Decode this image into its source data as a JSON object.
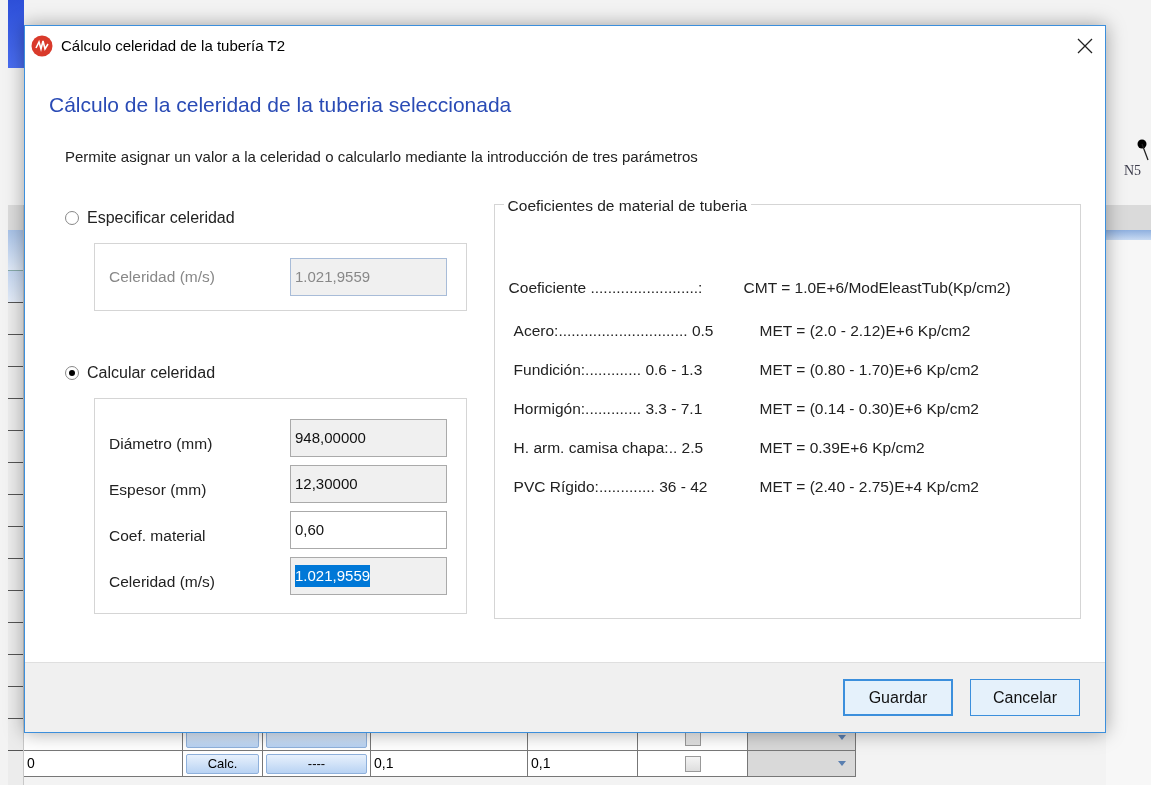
{
  "background": {
    "node_label": "N5",
    "table": {
      "rows": [
        {
          "checked": false
        },
        {
          "cells": [
            "0",
            "Calc.",
            "----",
            "0,1",
            "0,1"
          ],
          "checked": false
        }
      ]
    }
  },
  "dialog": {
    "title": "Cálculo celeridad de la tubería T2",
    "heading": "Cálculo de la celeridad de la tuberia seleccionada",
    "description": "Permite asignar un valor a la celeridad o calcularlo mediante la introducción de tres parámetros",
    "options": [
      {
        "label": "Especificar celeridad",
        "selected": false,
        "fields": [
          {
            "label": "Celeridad (m/s)",
            "value": "1.021,9559",
            "readonly": true,
            "disabled": true,
            "highlighted": false
          }
        ]
      },
      {
        "label": "Calcular celeridad",
        "selected": true,
        "fields": [
          {
            "label": "Diámetro (mm)",
            "value": "948,00000",
            "readonly": true,
            "disabled": false,
            "highlighted": false
          },
          {
            "label": "Espesor (mm)",
            "value": "12,30000",
            "readonly": true,
            "disabled": false,
            "highlighted": false
          },
          {
            "label": "Coef. material",
            "value": "0,60",
            "readonly": false,
            "disabled": false,
            "highlighted": false
          },
          {
            "label": "Celeridad (m/s)",
            "value": "1.021,9559",
            "readonly": true,
            "disabled": false,
            "highlighted": true
          }
        ]
      }
    ],
    "coefficients": {
      "title": "Coeficientes de material de tuberia",
      "header": {
        "label": "Coeficiente .........................:",
        "formula": "CMT = 1.0E+6/ModEleastTub(Kp/cm2)"
      },
      "materials": [
        {
          "label": "Acero:.............................. 0.5",
          "formula": "MET = (2.0 - 2.12)E+6 Kp/cm2"
        },
        {
          "label": "Fundición:............. 0.6 - 1.3",
          "formula": "MET = (0.80 - 1.70)E+6 Kp/cm2"
        },
        {
          "label": "Hormigón:............. 3.3 - 7.1",
          "formula": "MET = (0.14 - 0.30)E+6 Kp/cm2"
        },
        {
          "label": "H. arm. camisa chapa:.. 2.5",
          "formula": "MET = 0.39E+6 Kp/cm2"
        },
        {
          "label": "PVC Rígido:............. 36 - 42",
          "formula": "MET = (2.40 - 2.75)E+4 Kp/cm2"
        }
      ]
    },
    "buttons": [
      {
        "label": "Guardar",
        "default": true
      },
      {
        "label": "Cancelar",
        "default": false
      }
    ]
  }
}
